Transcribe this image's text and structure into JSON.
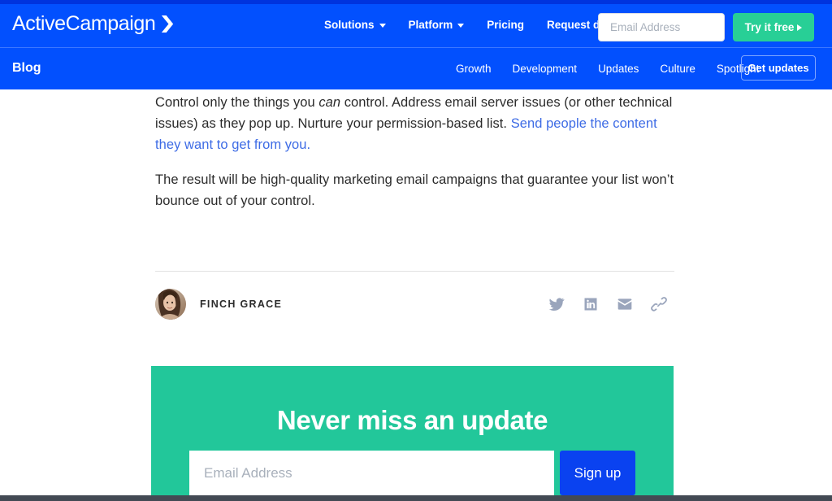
{
  "theme": {
    "brand_blue": "#0250fe",
    "brand_blue_dark": "#0033dd",
    "accent_green": "#28cf96",
    "cta_green": "#22c79a",
    "signup_blue": "#0a42f0",
    "link_blue": "#3d6be5",
    "social_icon_gray": "#9aa5bc",
    "bottom_bar": "#434a54"
  },
  "header": {
    "logo_text": "ActiveCampaign",
    "logo_chevron": "chevron-right-logo",
    "nav": [
      {
        "label": "Solutions",
        "has_dropdown": true
      },
      {
        "label": "Platform",
        "has_dropdown": true
      },
      {
        "label": "Pricing",
        "has_dropdown": false
      },
      {
        "label": "Request demo",
        "has_dropdown": false
      }
    ],
    "email_input": {
      "placeholder": "Email Address",
      "value": ""
    },
    "cta_button": {
      "label": "Try it free",
      "icon": "play-triangle-icon"
    }
  },
  "subheader": {
    "title": "Blog",
    "nav": [
      {
        "label": "Growth"
      },
      {
        "label": "Development"
      },
      {
        "label": "Updates"
      },
      {
        "label": "Culture"
      },
      {
        "label": "Spotlight"
      }
    ],
    "get_updates_label": "Get updates"
  },
  "article": {
    "paragraph_1": {
      "part_1": "Control only the things you ",
      "emphasis": "can",
      "part_2": " control. Address email server issues (or other technical issues) as they pop up. Nurture your permission-based list. ",
      "link_text": "Send people the content they want to get from you."
    },
    "paragraph_2": "The result will be high-quality marketing email campaigns that guarantee your list won’t bounce out of your control."
  },
  "author": {
    "name": "FINCH GRACE",
    "avatar_alt": "author-avatar-photo",
    "social": [
      {
        "name": "twitter-icon",
        "label": "Twitter"
      },
      {
        "name": "linkedin-icon",
        "label": "LinkedIn"
      },
      {
        "name": "email-icon",
        "label": "Email"
      },
      {
        "name": "link-icon",
        "label": "Copy link"
      }
    ]
  },
  "newsletter_cta": {
    "title": "Never miss an update",
    "email_input": {
      "placeholder": "Email Address",
      "value": ""
    },
    "signup_label": "Sign up"
  }
}
